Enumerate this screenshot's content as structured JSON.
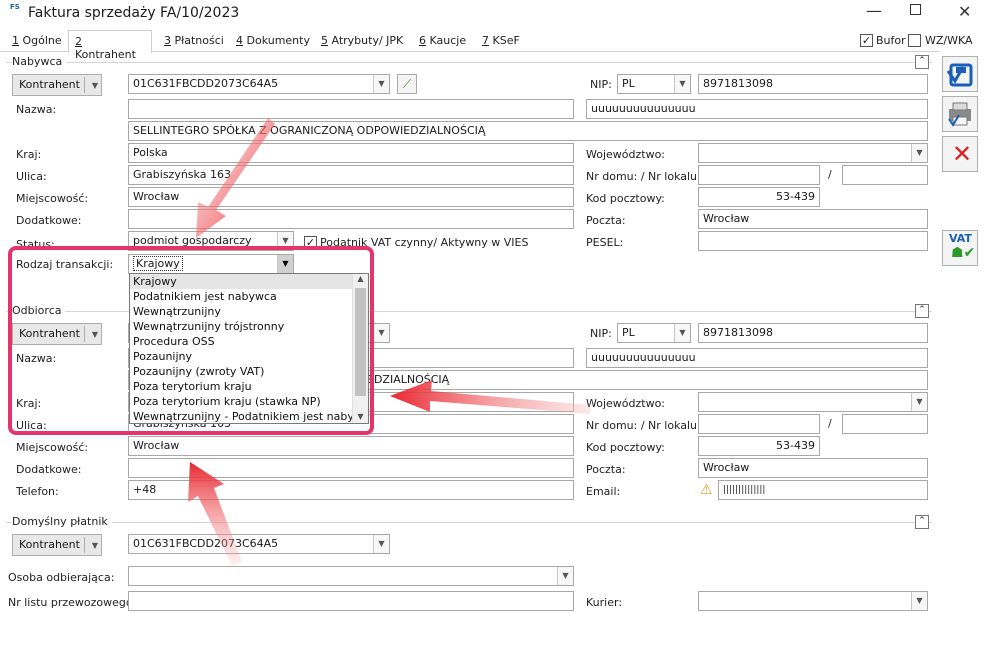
{
  "window": {
    "icon_text": "FS",
    "title": "Faktura sprzedaży FA/10/2023"
  },
  "tabs": [
    {
      "key": "1",
      "label": " Ogólne"
    },
    {
      "key": "2",
      "label": " Kontrahent"
    },
    {
      "key": "3",
      "label": " Płatności"
    },
    {
      "key": "4",
      "label": " Dokumenty"
    },
    {
      "key": "5",
      "label": " Atrybuty/ JPK"
    },
    {
      "key": "6",
      "label": " Kaucje"
    },
    {
      "key": "7",
      "label": " KSeF"
    }
  ],
  "toggles": {
    "bufor": "Bufor",
    "wzwka": "WZ/WKA"
  },
  "nabywca": {
    "group": "Nabywca",
    "kontrahent_btn": "Kontrahent",
    "code": "01C631FBCDD2073C64A5",
    "nip_label": "NIP:",
    "nip_country": "PL",
    "nip": "8971813098",
    "nazwa_label": "Nazwa:",
    "nazwa1": "",
    "nazwa_right": "uuuuuuuuuuuuuuu",
    "nazwa2": "SELLINTEGRO SPÓŁKA Z OGRANICZONĄ ODPOWIEDZIALNOŚCIĄ",
    "kraj_label": "Kraj:",
    "kraj": "Polska",
    "woj_label": "Województwo:",
    "ulica_label": "Ulica:",
    "ulica": "Grabiszyńska 163",
    "nrdomu_label": "Nr domu: / Nr lokalu:",
    "slash": "/",
    "miejsc_label": "Miejscowość:",
    "miejsc": "Wrocław",
    "kod_label": "Kod pocztowy:",
    "kod": "53-439",
    "dodatkowe_label": "Dodatkowe:",
    "poczta_label": "Poczta:",
    "poczta": "Wrocław",
    "status_label": "Status:",
    "status": "podmiot gospodarczy",
    "vat_label": "Podatnik VAT czynny/ Aktywny w VIES",
    "pesel_label": "PESEL:",
    "rodzaj_label": "Rodzaj transakcji:",
    "rodzaj": "Krajowy"
  },
  "dropdown_items": [
    "Krajowy",
    "Podatnikiem jest nabywca",
    "Wewnątrzunijny",
    "Wewnątrzunijny trójstronny",
    "Procedura OSS",
    "Pozaunijny",
    "Pozaunijny (zwroty VAT)",
    "Poza terytorium kraju",
    "Poza terytorium kraju (stawka NP)",
    "Wewnątrzunijny - Podatnikiem jest nabywca"
  ],
  "odbiorca": {
    "group": "Odbiorca",
    "kontrahent_btn": "Kontrahent",
    "nip_label": "NIP:",
    "nip_country": "PL",
    "nip": "8971813098",
    "nazwa_label": "Nazwa:",
    "nazwa_right": "uuuuuuuuuuuuuuu",
    "nazwa2_tail": "EDZIALNOŚCIĄ",
    "kraj_label": "Kraj:",
    "woj_label": "Województwo:",
    "ulica_label": "Ulica:",
    "ulica": "Grabiszyńska 163",
    "nrdomu_label": "Nr domu: / Nr lokalu:",
    "slash": "/",
    "miejsc_label": "Miejscowość:",
    "miejsc": "Wrocław",
    "kod_label": "Kod pocztowy:",
    "kod": "53-439",
    "dodatkowe_label": "Dodatkowe:",
    "poczta_label": "Poczta:",
    "poczta": "Wrocław",
    "telefon_label": "Telefon:",
    "telefon": "+48",
    "email_label": "Email:",
    "email": "||||||||||||||"
  },
  "platnik": {
    "group": "Domyślny płatnik",
    "kontrahent_btn": "Kontrahent",
    "code": "01C631FBCDD2073C64A5"
  },
  "bottom": {
    "osoba_label": "Osoba odbierająca:",
    "nrlistu_label": "Nr listu przewozowego:",
    "kurier_label": "Kurier:"
  },
  "side_buttons": {
    "vat": "VAT"
  },
  "colors": {
    "highlight": "#e5336b",
    "arrow": "#e8262f",
    "save_blue": "#1b5fb8",
    "delete_red": "#d8231c"
  }
}
